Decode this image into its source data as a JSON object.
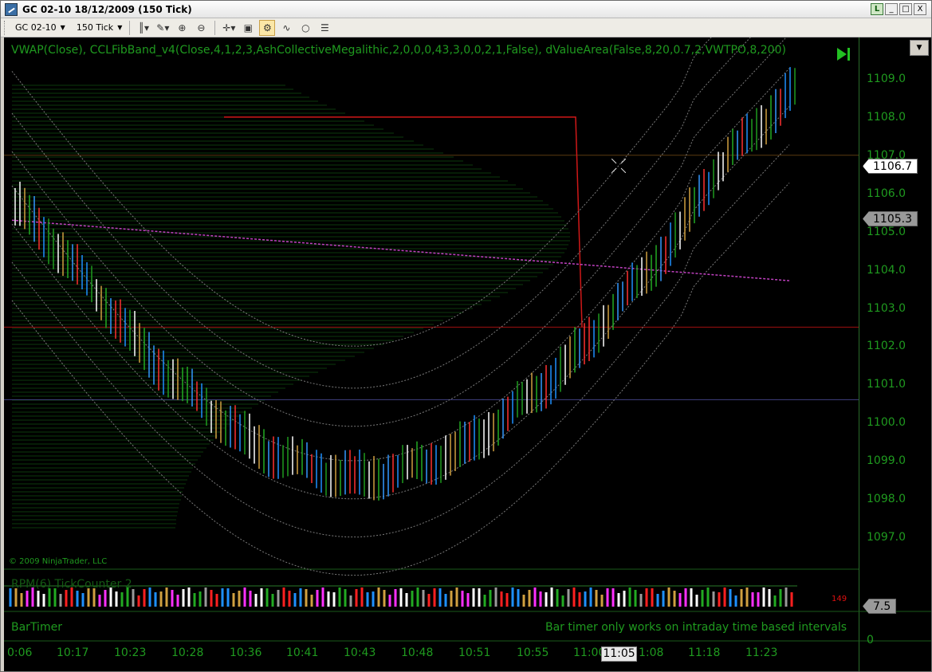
{
  "window": {
    "title": "GC 02-10  18/12/2009 (150 Tick)",
    "buttons": {
      "link": "L",
      "minimize": "_",
      "maximize": "□",
      "close": "X"
    }
  },
  "toolbar": {
    "instrument": "GC 02-10",
    "interval": "150 Tick"
  },
  "chart": {
    "indicator_label": "VWAP(Close),  CCLFibBand_v4(Close,4,1,2,3,AshCollectiveMegalithic,2,0,0,0,43,3,0,0,2,1,False),  dValueArea(False,8,20,0.7,2,VWTPO,8,200)",
    "copyright": "© 2009 NinjaTrader, LLC",
    "price_ticks": [
      "1109.0",
      "1108.0",
      "1107.0",
      "1106.0",
      "1105.0",
      "1104.0",
      "1103.0",
      "1102.0",
      "1101.0",
      "1100.0",
      "1099.0",
      "1098.0",
      "1097.0"
    ],
    "price_tag_1": "1106.7",
    "price_tag_2": "1105.3",
    "time_ticks": [
      "0:06",
      "10:17",
      "10:23",
      "10:28",
      "10:36",
      "10:41",
      "10:43",
      "10:48",
      "10:51",
      "10:55",
      "11:00",
      "1:08",
      "11:18",
      "11:23"
    ],
    "time_cursor": "11:05",
    "colors": {
      "background": "#000000",
      "axis_text": "#1f9a1f",
      "vwap": "#c040c0",
      "bands": "#8a8a8a",
      "line_red": "#d01818"
    }
  },
  "rpm_panel": {
    "label": "RPM(6)  TickCounter 2",
    "counter": "149",
    "axis_tag": "7.5"
  },
  "bartimer_panel": {
    "label": "BarTimer",
    "message": "Bar timer only works on intraday time based intervals",
    "axis_zero": "0"
  }
}
